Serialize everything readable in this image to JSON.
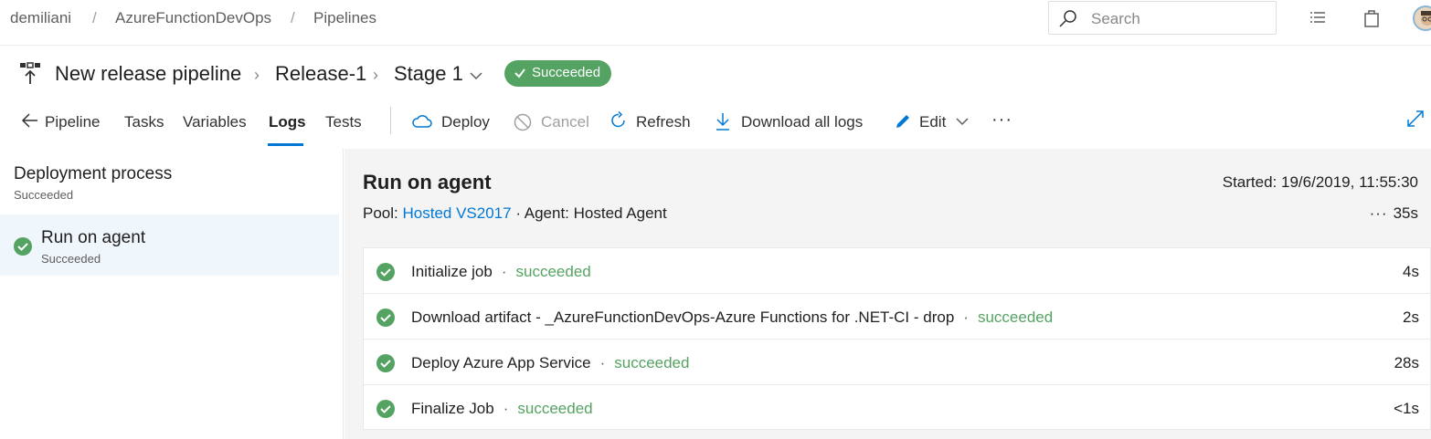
{
  "breadcrumb": {
    "org": "demiliani",
    "project": "AzureFunctionDevOps",
    "section": "Pipelines",
    "separator": "/"
  },
  "search": {
    "placeholder": "Search"
  },
  "header": {
    "pipeline": "New release pipeline",
    "release": "Release-1",
    "stage": "Stage 1",
    "status": "Succeeded"
  },
  "tabs": [
    {
      "label": "Pipeline"
    },
    {
      "label": "Tasks"
    },
    {
      "label": "Variables"
    },
    {
      "label": "Logs",
      "active": true
    },
    {
      "label": "Tests"
    }
  ],
  "toolbar": {
    "deploy": "Deploy",
    "cancel": "Cancel",
    "refresh": "Refresh",
    "download": "Download all logs",
    "edit": "Edit",
    "more": "···"
  },
  "left": {
    "process_title": "Deployment process",
    "process_status": "Succeeded",
    "job_title": "Run on agent",
    "job_status": "Succeeded"
  },
  "job": {
    "title": "Run on agent",
    "started": "Started: 19/6/2019, 11:55:30",
    "pool_label": "Pool:",
    "pool_name": "Hosted VS2017",
    "agent": "· Agent: Hosted Agent",
    "more": "···",
    "duration": "35s",
    "steps": [
      {
        "name": "Initialize job",
        "status": "succeeded",
        "time": "4s"
      },
      {
        "name": "Download artifact - _AzureFunctionDevOps-Azure Functions for .NET-CI - drop",
        "status": "succeeded",
        "time": "2s"
      },
      {
        "name": "Deploy Azure App Service",
        "status": "succeeded",
        "time": "28s"
      },
      {
        "name": "Finalize Job",
        "status": "succeeded",
        "time": "<1s"
      }
    ]
  },
  "colors": {
    "accent": "#0078d4",
    "success": "#55a362"
  }
}
